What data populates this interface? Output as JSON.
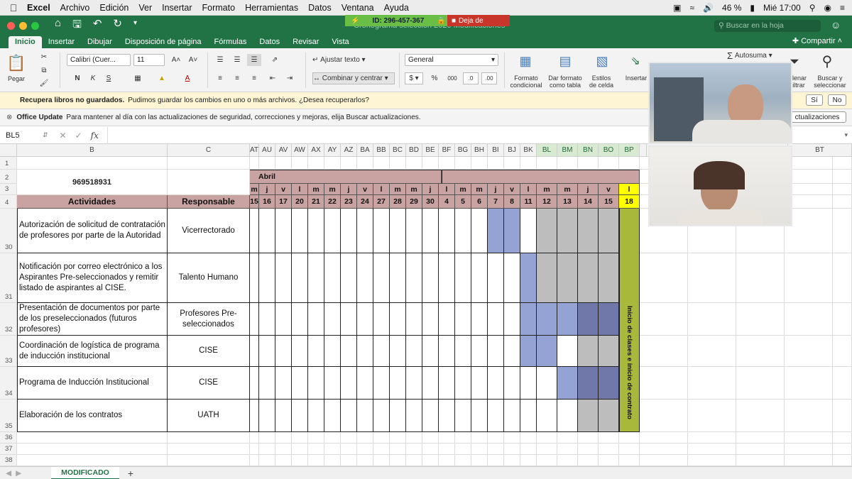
{
  "menubar": {
    "app": "Excel",
    "items": [
      "Archivo",
      "Edición",
      "Ver",
      "Insertar",
      "Formato",
      "Herramientas",
      "Datos",
      "Ventana",
      "Ayuda"
    ],
    "battery": "46 %",
    "clock": "Mié 17:00"
  },
  "zoom_bar": {
    "meeting_id": "ID: 296-457-367",
    "stop_label": "Deja de"
  },
  "titlebar": {
    "doc_title": "Cronograma selección 2020 Modificaciones",
    "search_placeholder": "Buscar en la hoja"
  },
  "tabs": [
    "Inicio",
    "Insertar",
    "Dibujar",
    "Disposición de página",
    "Fórmulas",
    "Datos",
    "Revisar",
    "Vista"
  ],
  "share_label": "Compartir",
  "ribbon": {
    "paste": "Pegar",
    "font_name": "Calibri (Cuer...",
    "font_size": "11",
    "wrap_text": "Ajustar texto",
    "merge_center": "Combinar y centrar",
    "number_format": "General",
    "cond_format": [
      "Formato",
      "condicional"
    ],
    "format_table": [
      "Dar formato",
      "como tabla"
    ],
    "cell_styles": [
      "Estilos",
      "de celda"
    ],
    "insert": "Insertar",
    "autosum": "Autosuma",
    "filter": [
      "llenar",
      "iltrar"
    ],
    "find_select": [
      "Buscar y",
      "seleccionar"
    ]
  },
  "messages": {
    "recover_bold": "Recupera libros no guardados.",
    "recover_text": "Pudimos guardar los cambios en uno o más archivos. ¿Desea recuperarlos?",
    "yes": "Sí",
    "no": "No",
    "update_bold": "Office Update",
    "update_text": "Para mantener al día con las actualizaciones de seguridad, correcciones y mejoras, elija Buscar actualizaciones.",
    "update_button": "ctualizaciones"
  },
  "formula_bar": {
    "name_box": "BL5",
    "fx": "fx"
  },
  "grid": {
    "columns": [
      "B",
      "C",
      "AT",
      "AU",
      "AV",
      "AW",
      "AX",
      "AY",
      "AZ",
      "BA",
      "BB",
      "BC",
      "BD",
      "BE",
      "BF",
      "BG",
      "BH",
      "BI",
      "BJ",
      "BK",
      "BL",
      "BM",
      "BN",
      "BO",
      "BP",
      "BT"
    ],
    "rows": [
      "1",
      "2",
      "3",
      "4",
      "30",
      "31",
      "32",
      "33",
      "34",
      "35",
      "36",
      "37",
      "38"
    ],
    "phone": "969518931",
    "month": "Abril",
    "day_letters": [
      "m",
      "j",
      "v",
      "l",
      "m",
      "m",
      "j",
      "v",
      "l",
      "m",
      "m",
      "j",
      "l",
      "m",
      "m",
      "j",
      "v",
      "l",
      "m",
      "m",
      "j",
      "v",
      "l"
    ],
    "day_numbers": [
      "15",
      "16",
      "17",
      "20",
      "21",
      "22",
      "23",
      "24",
      "27",
      "28",
      "29",
      "30",
      "4",
      "5",
      "6",
      "7",
      "8",
      "11",
      "12",
      "13",
      "14",
      "15",
      "18"
    ],
    "activities_header": "Actividades",
    "responsible_header": "Responsable",
    "activities": [
      {
        "row": "30",
        "text": "Autorización de solicitud de contratación de profesores por parte de la Autoridad",
        "resp": "Vicerrectorado"
      },
      {
        "row": "31",
        "text": "Notificación por correo electrónico a los Aspirantes Pre-seleccionados y remitir listado de aspirantes al CISE.",
        "resp": "Talento Humano"
      },
      {
        "row": "32",
        "text": "Presentación de documentos por parte de los preseleccionados (futuros profesores)",
        "resp": "Profesores Pre-seleccionados"
      },
      {
        "row": "33",
        "text": "Coordinación de logística de programa de inducción institucional",
        "resp": "CISE"
      },
      {
        "row": "34",
        "text": "Programa de Inducción Institucional",
        "resp": "CISE"
      },
      {
        "row": "35",
        "text": "Elaboración de los contratos",
        "resp": "UATH"
      }
    ],
    "milestone": "Inicio de clases e inicio de contrato",
    "colors": {
      "header": "#c9a2a2",
      "blue": "#95a3d4",
      "dark_blue": "#6f78a8",
      "gray": "#bdbdbd",
      "milestone": "#a8b83a",
      "today": "#ffff00"
    }
  },
  "sheet_tab": "MODIFICADO"
}
